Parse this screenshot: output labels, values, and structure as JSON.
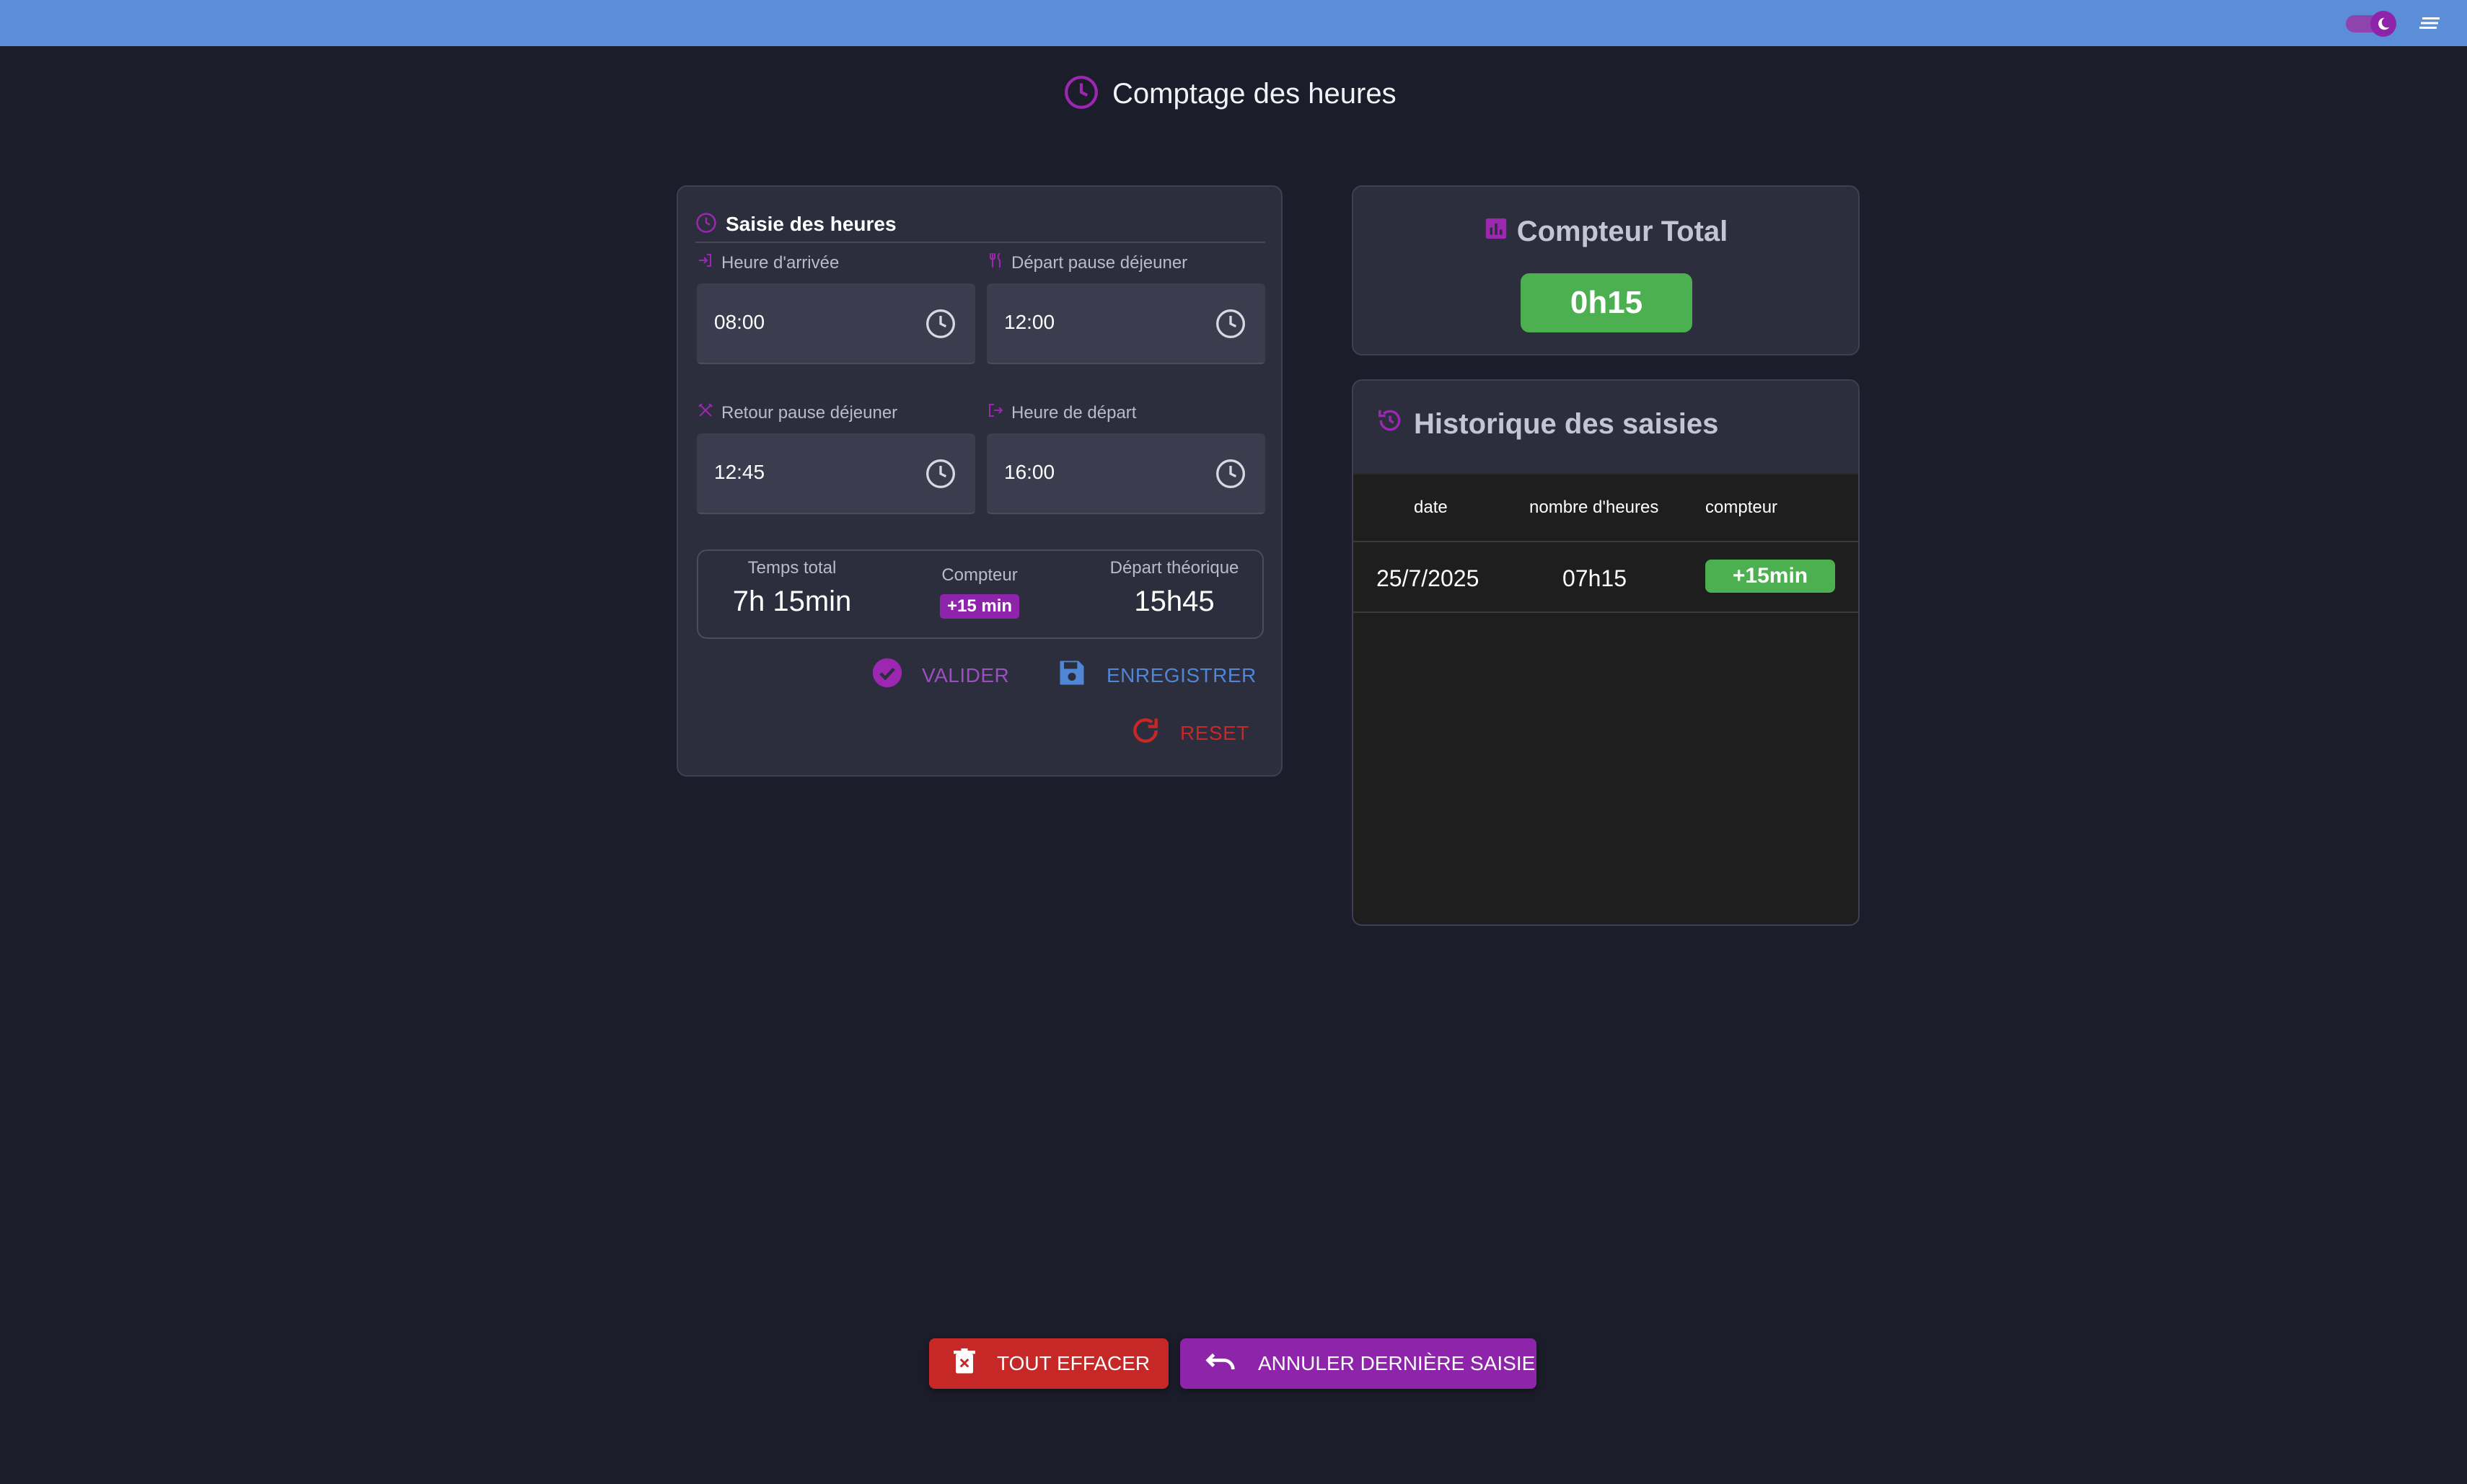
{
  "app": {
    "title": "Comptage des heures"
  },
  "header": {
    "theme_toggle_icon": "moon-icon",
    "menu_icon": "menu-icon"
  },
  "saisie": {
    "title": "Saisie des heures",
    "fields": [
      {
        "label": "Heure d'arrivée",
        "value": "08:00",
        "icon": "login-icon"
      },
      {
        "label": "Départ pause déjeuner",
        "value": "12:00",
        "icon": "fork-knife-icon"
      },
      {
        "label": "Retour pause déjeuner",
        "value": "12:45",
        "icon": "utensils-crossed-icon"
      },
      {
        "label": "Heure de départ",
        "value": "16:00",
        "icon": "logout-icon"
      }
    ],
    "summary": {
      "total_label": "Temps total",
      "total_value": "7h 15min",
      "compteur_label": "Compteur",
      "compteur_value": "+15 min",
      "depart_label": "Départ théorique",
      "depart_value": "15h45"
    },
    "actions": {
      "valider": "VALIDER",
      "enregistrer": "ENREGISTRER",
      "reset": "RESET"
    }
  },
  "compteur_total": {
    "title": "Compteur Total",
    "value": "0h15"
  },
  "historique": {
    "title": "Historique des saisies",
    "columns": [
      "date",
      "nombre d'heures",
      "compteur"
    ],
    "rows": [
      {
        "date": "25/7/2025",
        "heures": "07h15",
        "compteur": "+15min"
      }
    ]
  },
  "bottom": {
    "effacer": "TOUT EFFACER",
    "annuler": "ANNULER DERNIÈRE SAISIE"
  },
  "colors": {
    "accent_purple": "#8e24aa",
    "accent_blue": "#4f86d6",
    "danger_red": "#c62828",
    "success_green": "#4caf50",
    "topbar_blue": "#5b8dd9"
  }
}
